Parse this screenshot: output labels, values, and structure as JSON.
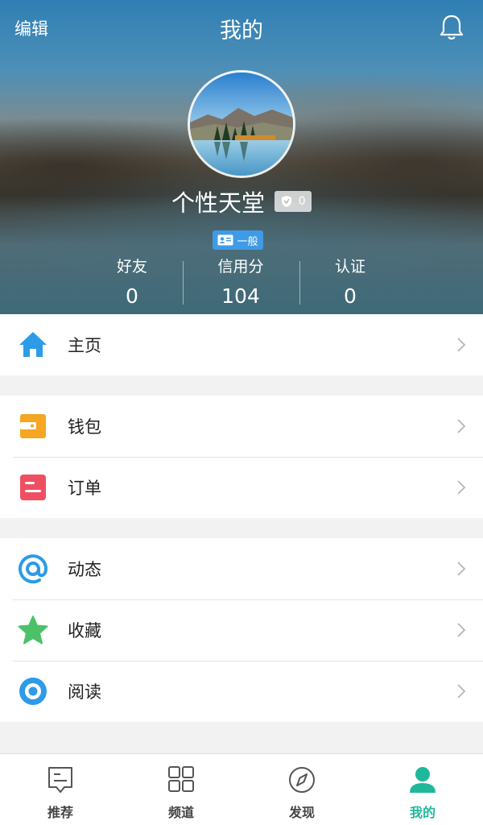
{
  "topbar": {
    "edit_label": "编辑",
    "title": "我的",
    "bell_icon": "bell-icon"
  },
  "profile": {
    "username": "个性天堂",
    "verify_count": "0",
    "level_label": "一般"
  },
  "stats": [
    {
      "label": "好友",
      "value": "0"
    },
    {
      "label": "信用分",
      "value": "104"
    },
    {
      "label": "认证",
      "value": "0"
    }
  ],
  "menu": {
    "home": {
      "label": "主页",
      "icon": "home-icon",
      "color": "#2d9be8"
    },
    "wallet": {
      "label": "钱包",
      "icon": "wallet-icon",
      "color": "#f5a623"
    },
    "orders": {
      "label": "订单",
      "icon": "order-icon",
      "color": "#ef4f63"
    },
    "activity": {
      "label": "动态",
      "icon": "at-icon",
      "color": "#2d9be8"
    },
    "favorites": {
      "label": "收藏",
      "icon": "star-icon",
      "color": "#4cc16a"
    },
    "reading": {
      "label": "阅读",
      "icon": "eye-icon",
      "color": "#2d9be8"
    }
  },
  "tabs": [
    {
      "label": "推荐",
      "icon": "recommend-icon"
    },
    {
      "label": "频道",
      "icon": "grid-icon"
    },
    {
      "label": "发现",
      "icon": "compass-icon"
    },
    {
      "label": "我的",
      "icon": "user-icon",
      "active": true
    }
  ],
  "colors": {
    "accent": "#1fb89a",
    "level_badge": "#3f9be6"
  }
}
